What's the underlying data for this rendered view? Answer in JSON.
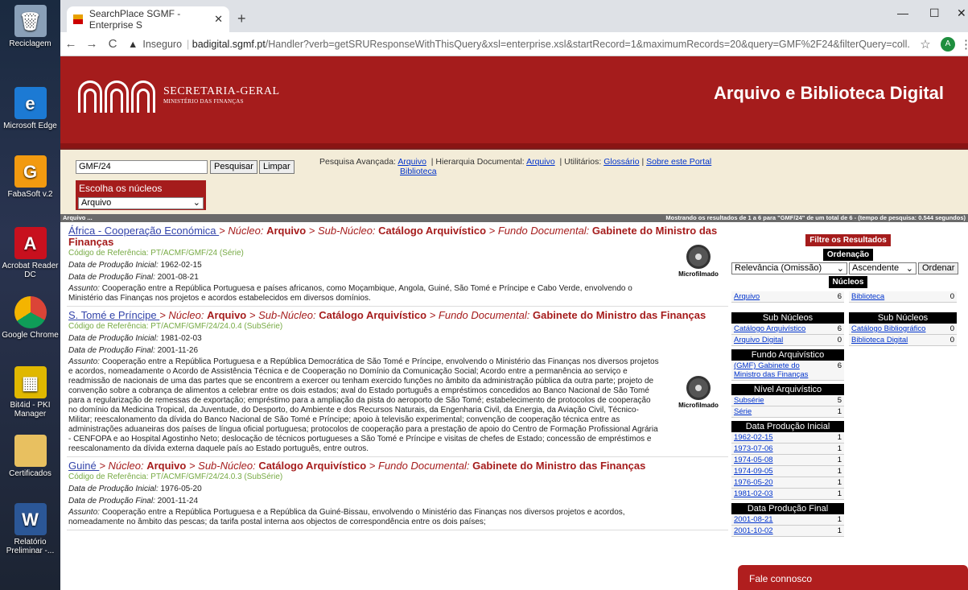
{
  "desktop": {
    "icons": [
      {
        "label": "Reciclagem",
        "icon": "recycle-bin-icon"
      },
      {
        "label": "Microsoft Edge",
        "icon": "edge-icon"
      },
      {
        "label": "FabaSoft v.2",
        "icon": "fabasoft-icon"
      },
      {
        "label": "Acrobat Reader DC",
        "icon": "acrobat-icon"
      },
      {
        "label": "Google Chrome",
        "icon": "chrome-icon"
      },
      {
        "label": "Bit4id - PKI Manager",
        "icon": "bit4id-icon"
      },
      {
        "label": "Certificados",
        "icon": "folder-icon"
      },
      {
        "label": "Relatório Preliminar -...",
        "icon": "word-icon"
      }
    ]
  },
  "browser": {
    "tab_title": "SearchPlace SGMF - Enterprise S",
    "url_security": "Inseguro",
    "url_domain": "badigital.sgmf.pt",
    "url_path": "/Handler?verb=getSRUResponseWithThisQuery&xsl=enterprise.xsl&startRecord=1&maximumRecords=20&query=GMF%2F24&filterQuery=coll...",
    "avatar_letter": "A"
  },
  "site": {
    "logo_line1": "SECRETARIA-GERAL",
    "logo_line2": "MINISTÉRIO DAS FINANÇAS",
    "title": "Arquivo e Biblioteca Digital"
  },
  "search": {
    "query": "GMF/24",
    "search_btn": "Pesquisar",
    "clear_btn": "Limpar",
    "nucleos_label": "Escolha os núcleos",
    "nucleos_selected": "Arquivo",
    "adv_label": "Pesquisa Avançada:",
    "adv_arquivo": "Arquivo",
    "adv_biblioteca": "Biblioteca",
    "hier_label": "| Hierarquia Documental:",
    "hier_arquivo": "Arquivo",
    "util_label": "| Utilitários:",
    "glossario": "Glossário",
    "sobre": "Sobre este Portal"
  },
  "status": {
    "left": "Arquivo ...",
    "right": "Mostrando os resultados de 1 a 6 para \"GMF/24\" de um total de 6 - (tempo de pesquisa: 0.544 segundos)"
  },
  "results": [
    {
      "title": "África - Cooperação Económica ",
      "nucleo": "Arquivo",
      "subnucleo": "Catálogo Arquivístico",
      "fundo": "Gabinete do Ministro das Finanças",
      "ref": "Código de Referência: PT/ACMF/GMF/24 (Série)",
      "data_ini": "1962-02-15",
      "data_fim": "2001-08-21",
      "assunto": "Cooperação entre a República Portuguesa e países africanos, como Moçambique, Angola, Guiné, São Tomé e Príncipe e Cabo Verde, envolvendo o Ministério das Finanças nos projetos e acordos estabelecidos em diversos domínios."
    },
    {
      "title": "S. Tomé e Príncipe ",
      "nucleo": "Arquivo",
      "subnucleo": "Catálogo Arquivístico",
      "fundo": "Gabinete do Ministro das Finanças",
      "ref": "Código de Referência: PT/ACMF/GMF/24/24.0.4 (SubSérie)",
      "data_ini": "1981-02-03",
      "data_fim": "2001-11-26",
      "assunto": "Cooperação entre a República Portuguesa e a República Democrática de São Tomé e Príncipe, envolvendo o Ministério das Finanças nos diversos projetos e acordos, nomeadamente o Acordo de Assistência Técnica e de Cooperação no Domínio da Comunicação Social; Acordo entre a permanência ao serviço e readmissão de nacionais de uma das partes que se encontrem a exercer ou tenham exercido funções no âmbito da administração pública da outra parte; projeto de convenção sobre a cobrança de alimentos a celebrar entre os dois estados; aval do Estado português a empréstimos concedidos ao Banco Nacional de São Tomé para a regularização de remessas de exportação; empréstimo para a ampliação da pista do aeroporto de São Tomé; estabelecimento de protocolos de cooperação no domínio da Medicina Tropical, da Juventude, do Desporto, do Ambiente e dos Recursos Naturais, da Engenharia Civil, da Energia, da Aviação Civil, Técnico-Militar; reescalonamento da dívida do Banco Nacional de São Tomé e Príncipe; apoio à televisão experimental; convenção de cooperação técnica entre as administrações aduaneiras dos países de língua oficial portuguesa; protocolos de cooperação para a prestação de apoio do Centro de Formação Profissional Agrária - CENFOPA e ao Hospital Agostinho Neto; deslocação de técnicos portugueses a São Tomé e Príncipe e visitas de chefes de Estado; concessão de empréstimos e reescalonamento da dívida externa daquele país ao Estado português, entre outros."
    },
    {
      "title": "Guiné ",
      "nucleo": "Arquivo",
      "subnucleo": "Catálogo Arquivístico",
      "fundo": "Gabinete do Ministro das Finanças",
      "ref": "Código de Referência: PT/ACMF/GMF/24/24.0.3 (SubSérie)",
      "data_ini": "1976-05-20",
      "data_fim": "2001-11-24",
      "assunto": "Cooperação entre a República Portuguesa e a República da Guiné-Bissau, envolvendo o Ministério das Finanças nos diversos projetos e acordos, nomeadamente no âmbito das pescas; da tarifa postal interna aos objectos de correspondência entre os dois países;"
    }
  ],
  "labels": {
    "nucleo": " > Núcleo: ",
    "subnucleo": " > Sub-Núcleo: ",
    "fundo": " > Fundo Documental: ",
    "data_ini": "Data de Produção Inicial: ",
    "data_fim": "Data de Produção Final: ",
    "assunto": "Assunto: ",
    "microfilmado": "Microfilmado"
  },
  "filters": {
    "title": "Filtre os Resultados",
    "ordenacao": "Ordenação",
    "ord_sel1": "Relevância (Omissão)",
    "ord_sel2": "Ascendente",
    "ordenar": "Ordenar",
    "nucleos": "Núcleos",
    "nuc_left": {
      "name": "Arquivo",
      "count": "6"
    },
    "nuc_right": {
      "name": "Biblioteca",
      "count": "0"
    },
    "sub_nucleos": "Sub Núcleos",
    "sub_left": [
      {
        "name": "Catálogo Arquivístico",
        "count": "6"
      },
      {
        "name": "Arquivo Digital",
        "count": "0"
      }
    ],
    "sub_right": [
      {
        "name": "Catálogo Bibliográfico",
        "count": "0"
      },
      {
        "name": "Biblioteca Digital",
        "count": "0"
      }
    ],
    "fundo": "Fundo Arquivístico",
    "fundo_items": [
      {
        "name": "(GMF) Gabinete do Ministro das Finanças",
        "count": "6"
      }
    ],
    "nivel": "Nível Arquivístico",
    "nivel_items": [
      {
        "name": "Subsérie",
        "count": "5"
      },
      {
        "name": "Série",
        "count": "1"
      }
    ],
    "dpi": "Data Produção Inicial",
    "dpi_items": [
      {
        "name": "1962-02-15",
        "count": "1"
      },
      {
        "name": "1973-07-06",
        "count": "1"
      },
      {
        "name": "1974-05-08",
        "count": "1"
      },
      {
        "name": "1974-09-05",
        "count": "1"
      },
      {
        "name": "1976-05-20",
        "count": "1"
      },
      {
        "name": "1981-02-03",
        "count": "1"
      }
    ],
    "dpf": "Data Produção Final",
    "dpf_items": [
      {
        "name": "2001-08-21",
        "count": "1"
      },
      {
        "name": "2001-10-02",
        "count": "1"
      }
    ]
  },
  "fale": "Fale connosco"
}
